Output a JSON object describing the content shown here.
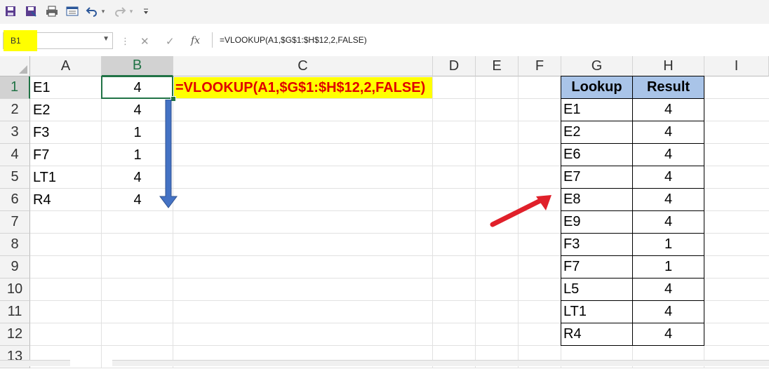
{
  "quick_access": {
    "icons": [
      "save-icon",
      "save-as-icon",
      "print-icon",
      "form-icon",
      "undo-icon",
      "redo-icon",
      "customize-icon"
    ]
  },
  "formula_bar": {
    "name_box": "B1",
    "cancel_glyph": "✕",
    "enter_glyph": "✓",
    "fx_label": "fx",
    "formula": "=VLOOKUP(A1,$G$1:$H$12,2,FALSE)"
  },
  "columns": [
    "A",
    "B",
    "C",
    "D",
    "E",
    "F",
    "G",
    "H",
    "I"
  ],
  "rows": [
    "1",
    "2",
    "3",
    "4",
    "5",
    "6",
    "7",
    "8",
    "9",
    "10",
    "11",
    "12",
    "13"
  ],
  "selected_cell": {
    "column": "B",
    "row": "1"
  },
  "col_a": [
    "E1",
    "E2",
    "F3",
    "F7",
    "LT1",
    "R4"
  ],
  "col_b": [
    "4",
    "4",
    "1",
    "1",
    "4",
    "4"
  ],
  "c1_formula_display": "=VLOOKUP(A1,$G$1:$H$12,2,FALSE)",
  "lookup_table": {
    "headers": [
      "Lookup",
      "Result"
    ],
    "rows": [
      [
        "E1",
        "4"
      ],
      [
        "E2",
        "4"
      ],
      [
        "E6",
        "4"
      ],
      [
        "E7",
        "4"
      ],
      [
        "E8",
        "4"
      ],
      [
        "E9",
        "4"
      ],
      [
        "F3",
        "1"
      ],
      [
        "F7",
        "1"
      ],
      [
        "L5",
        "4"
      ],
      [
        "LT1",
        "4"
      ],
      [
        "R4",
        "4"
      ]
    ]
  },
  "colors": {
    "highlight_yellow": "#ffff00",
    "formula_text_red": "#e00000",
    "header_blue": "#a9c4e8",
    "selection_green": "#217346",
    "fill_arrow_blue": "#4472c4",
    "annotation_red": "#e0202a"
  }
}
